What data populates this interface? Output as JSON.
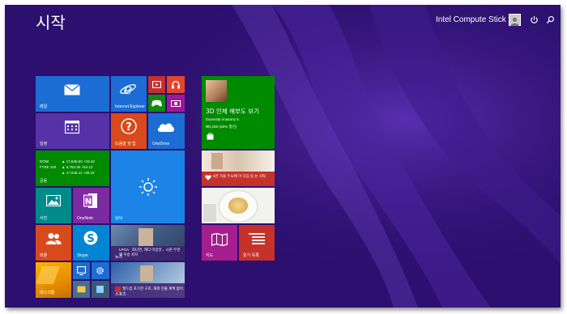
{
  "screen": {
    "title": "시작"
  },
  "user": {
    "name": "Intel Compute Stick"
  },
  "colors": {
    "background": "#2c0f6e",
    "mail": "#1b6dd3",
    "calendar": "#5533a6",
    "help": "#d84a1b",
    "onedrive": "#1b6dd3",
    "finance": "#008a00",
    "weather": "#1b84e6",
    "photos": "#008b8b",
    "onenote": "#7a2ba0",
    "people": "#d84a1b",
    "skype": "#0085d4",
    "health": "#008a00",
    "maps": "#a51e8e",
    "reading": "#c4322a"
  },
  "tiles": {
    "mail": {
      "label": "메일",
      "icon": "mail-icon"
    },
    "ie": {
      "label": "Internet Explorer",
      "icon": "ie-icon"
    },
    "video": {
      "icon": "video-icon"
    },
    "music": {
      "icon": "headphones-icon"
    },
    "games": {
      "icon": "gamepad-icon"
    },
    "camera": {
      "icon": "camera-icon"
    },
    "calendar": {
      "label": "일정",
      "icon": "calendar-icon"
    },
    "help": {
      "label": "도움말 및 팁",
      "icon": "help-icon"
    },
    "onedrive": {
      "label": "OneDrive",
      "icon": "cloud-icon"
    },
    "finance": {
      "label": "금융",
      "rows": [
        {
          "name": "DOW",
          "value": "▲ 17,646.60 +18.32"
        },
        {
          "name": "FTSE 100",
          "value": "▲ 6,753.30 +54.12"
        },
        {
          "name": "",
          "value": "▲ 17,645.11 +35.23"
        }
      ]
    },
    "weather": {
      "label": "날씨",
      "icon": "sun-icon"
    },
    "photos": {
      "label": "사진",
      "icon": "picture-icon"
    },
    "onenote": {
      "label": "OneNote",
      "icon": "onenote-icon"
    },
    "news": {
      "label": "뉴스",
      "headline": "LPGA · 최나연, 캐디 이글샷... 시즌 두번째 우승 차지"
    },
    "people": {
      "label": "피플",
      "icon": "people-icon"
    },
    "skype": {
      "label": "Skype",
      "icon": "skype-icon"
    },
    "desktop": {
      "label": "데스크톱"
    },
    "sports": {
      "label": "스포츠",
      "headline": "월드컵 포기한 구조, 해외 진출 계획 없어"
    },
    "health": {
      "title": "3D 인체 해부도 보기",
      "subtitle": "Essential Anatomy 5",
      "price": "₩1,000 (50% 할인)",
      "icon": "store-icon"
    },
    "food": {
      "label": "레시피",
      "headline": "5만 가을 두뇌에 이 다음 등 논 식탁"
    },
    "maps": {
      "label": "지도",
      "icon": "map-icon"
    },
    "reading": {
      "label": "읽기 목록",
      "icon": "reading-list-icon"
    }
  }
}
